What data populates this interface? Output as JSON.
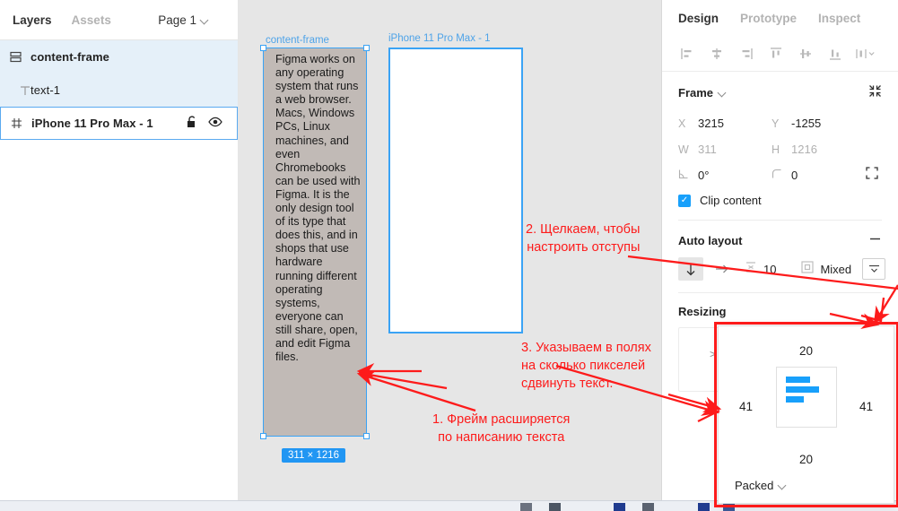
{
  "left_panel": {
    "tabs": [
      {
        "label": "Layers",
        "active": true
      },
      {
        "label": "Assets",
        "active": false
      }
    ],
    "page_selector": {
      "label": "Page 1",
      "icon": "chevron-down-icon"
    },
    "layers": [
      {
        "name": "content-frame",
        "icon": "auto-layout-frame-icon",
        "indent": 0,
        "selected": "soft"
      },
      {
        "name": "text-1",
        "icon": "text-layer-icon",
        "indent": 1,
        "selected": "soft"
      },
      {
        "name": "iPhone 11 Pro Max - 1",
        "icon": "frame-hash-icon",
        "indent": 0,
        "selected": "outline",
        "actions": [
          "unlock-icon",
          "eye-icon"
        ]
      }
    ]
  },
  "canvas": {
    "content_frame": {
      "label": "content-frame",
      "text": "Figma works on any operating system that runs a web browser. Macs, Windows PCs, Linux machines, and even Chromebooks can be used with Figma. It is the only design tool of its type that does this, and in shops that use hardware running different operating systems, everyone can still share, open, and edit Figma files.",
      "dimension_badge": "311 × 1216",
      "fill_color": "#c1bab6",
      "selection_color": "#3aa3f5"
    },
    "iphone_frame": {
      "label": "iPhone 11 Pro Max - 1",
      "fill_color": "#ffffff",
      "selection_color": "#3aa3f5"
    },
    "background_color": "#e6e6e6",
    "annotations": [
      {
        "id": "anno2",
        "text": "2. Щелкаем, чтобы\nнастроить отступы"
      },
      {
        "id": "anno3",
        "text": "3. Указываем в полях\nна сколько пикселей\nсдвинуть текст."
      },
      {
        "id": "anno1",
        "text": "1. Фрейм расширяется\nпо написанию текста"
      }
    ],
    "annotation_color": "#fd1b1b"
  },
  "right_panel": {
    "tabs": [
      {
        "label": "Design",
        "active": true
      },
      {
        "label": "Prototype",
        "active": false
      },
      {
        "label": "Inspect",
        "active": false
      }
    ],
    "align_buttons": [
      "align-left-icon",
      "align-horizontal-center-icon",
      "align-right-icon",
      "align-top-icon",
      "align-vertical-center-icon",
      "align-bottom-icon",
      "distribute-icon"
    ],
    "frame_section": {
      "title": "Frame",
      "title_icon": "chevron-down-icon",
      "collapse_icon": "collapse-arrows-icon",
      "props": [
        {
          "label": "X",
          "value": "3215",
          "dim": false
        },
        {
          "label": "Y",
          "value": "-1255",
          "dim": false
        },
        {
          "label": "W",
          "value": "311",
          "dim": true
        },
        {
          "label": "H",
          "value": "1216",
          "dim": true
        },
        {
          "label": "rotation-icon",
          "value": "0°",
          "dim": false
        },
        {
          "label": "corner-radius-icon",
          "value": "0",
          "dim": false
        }
      ],
      "independent_corners_icon": "independent-corners-icon",
      "clip_content": {
        "label": "Clip content",
        "checked": true,
        "accent": "#18a0fb"
      }
    },
    "auto_layout_section": {
      "title": "Auto layout",
      "remove_icon": "minus-icon",
      "direction_vertical_icon": "arrow-down-icon",
      "direction_horizontal_icon": "arrow-right-icon",
      "spacing_icon": "spacing-vertical-icon",
      "spacing_value": "10",
      "padding_icon": "padding-icon",
      "padding_value": "Mixed",
      "padding_more_icon": "padding-settings-icon"
    },
    "resizing_section": {
      "title": "Resizing"
    },
    "padding_popup": {
      "top": "20",
      "bottom": "20",
      "left": "41",
      "right": "41",
      "alignment": "Packed",
      "alignment_icon": "chevron-down-icon",
      "highlight_color": "#fd1b1b"
    }
  }
}
